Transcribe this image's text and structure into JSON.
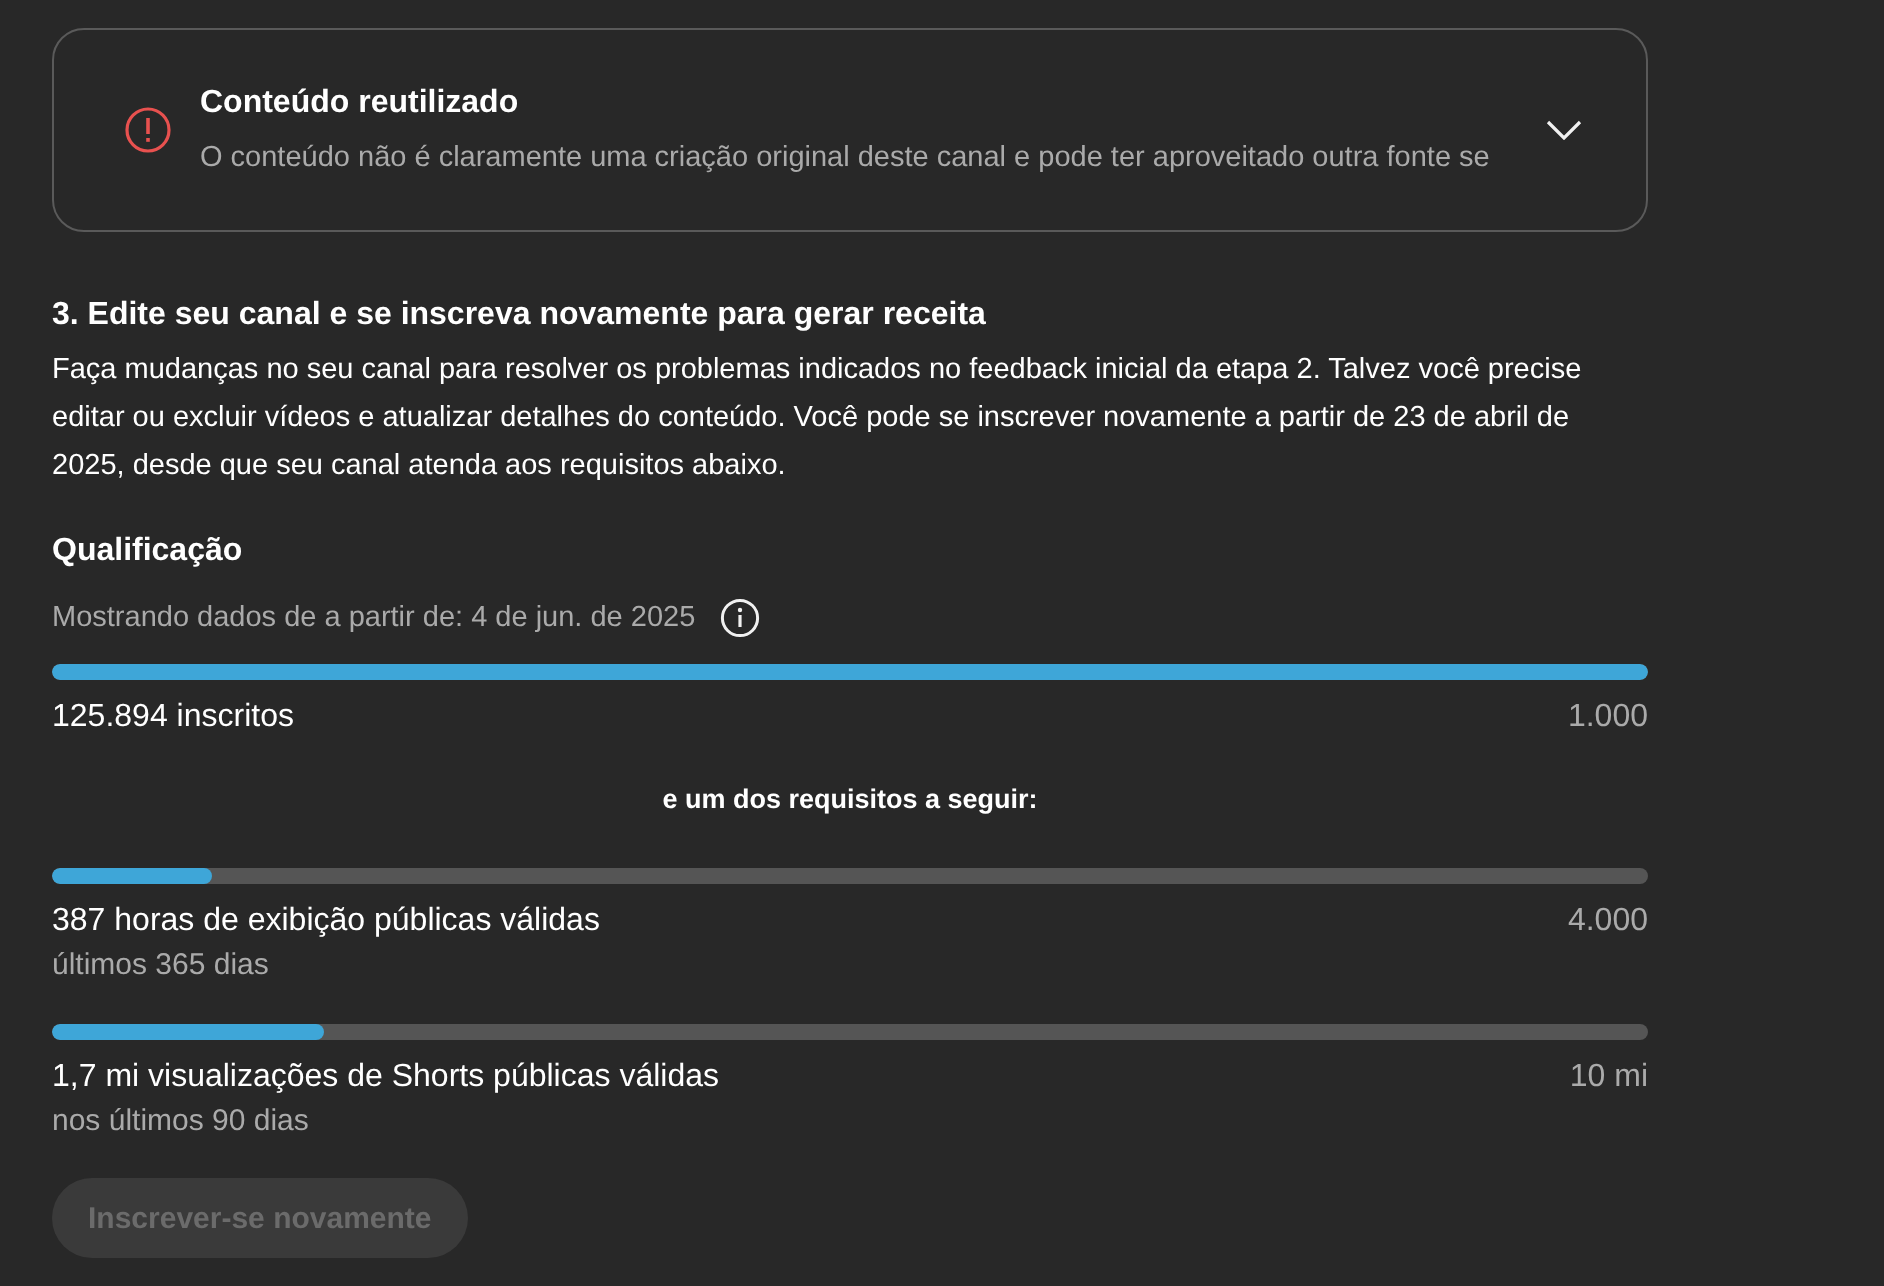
{
  "issue_card": {
    "title": "Conteúdo reutilizado",
    "description": "O conteúdo não é claramente uma criação original deste canal e pode ter aproveitado outra fonte se",
    "expanded": false
  },
  "step": {
    "heading": "3. Edite seu canal e se inscreva novamente para gerar receita",
    "body": "Faça mudanças no seu canal para resolver os problemas indicados no feedback inicial da etapa 2. Talvez você precise editar ou excluir vídeos e atualizar detalhes do conteúdo. Você pode se inscrever novamente a partir de 23 de abril de 2025, desde que seu canal atenda aos requisitos abaixo."
  },
  "qualification": {
    "heading": "Qualificação",
    "data_note": "Mostrando dados de a partir de: 4 de jun. de 2025",
    "requirements": [
      {
        "label": "125.894 inscritos",
        "target": "1.000",
        "level": 1.0
      },
      {
        "kind": "separator",
        "label": "e um dos requisitos a seguir:"
      },
      {
        "label": "387 horas de exibição públicas válidas",
        "period": "últimos 365 dias",
        "target": "4.000",
        "level": 0.1
      },
      {
        "label": "1,7 mi visualizações de Shorts públicas válidas",
        "period": "nos últimos 90 dias",
        "target": "10 mi",
        "level": 0.17
      }
    ]
  },
  "button": {
    "label": "Inscrever-se novamente",
    "disabled": true
  }
}
